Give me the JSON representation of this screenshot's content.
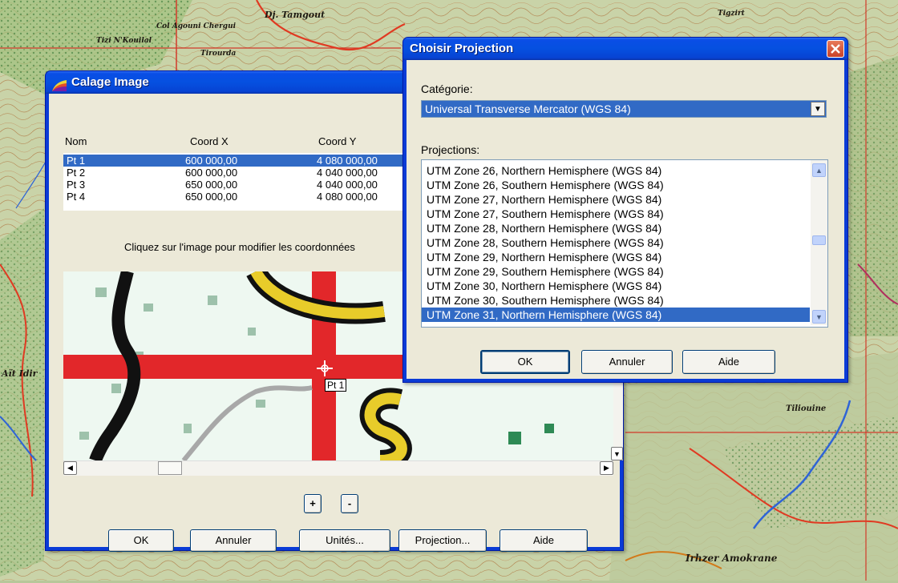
{
  "map": {
    "labels": [
      {
        "text": "Dj. Tamgout"
      },
      {
        "text": "Col Agouni Chergui"
      },
      {
        "text": "Tirourda"
      },
      {
        "text": "Tizi N'Kouilal"
      },
      {
        "text": "Irhzer Amokrane"
      },
      {
        "text": "Tigzirt"
      },
      {
        "text": "Tiliouine"
      },
      {
        "text": "Aït Idir"
      }
    ]
  },
  "calage": {
    "title": "Calage Image",
    "columns": [
      "Nom",
      "Coord X",
      "Coord Y"
    ],
    "points": [
      {
        "nom": "Pt 1",
        "x": "600 000,00",
        "y": "4 080 000,00",
        "selected": true
      },
      {
        "nom": "Pt 2",
        "x": "600 000,00",
        "y": "4 040 000,00",
        "selected": false
      },
      {
        "nom": "Pt 3",
        "x": "650 000,00",
        "y": "4 040 000,00",
        "selected": false
      },
      {
        "nom": "Pt 4",
        "x": "650 000,00",
        "y": "4 080 000,00",
        "selected": false
      }
    ],
    "instruction": "Cliquez sur l'image pour modifier les coordonnées",
    "marker_label": "Pt 1",
    "zoom_in": "+",
    "zoom_out": "-",
    "buttons": {
      "ok": "OK",
      "annuler": "Annuler",
      "unites": "Unités...",
      "projection": "Projection...",
      "aide": "Aide"
    }
  },
  "projection": {
    "title": "Choisir Projection",
    "categorie_label": "Catégorie:",
    "categorie_value": "Universal Transverse Mercator (WGS 84)",
    "projections_label": "Projections:",
    "items": [
      "UTM Zone 26, Northern Hemisphere (WGS 84)",
      "UTM Zone 26, Southern Hemisphere (WGS 84)",
      "UTM Zone 27, Northern Hemisphere (WGS 84)",
      "UTM Zone 27, Southern Hemisphere (WGS 84)",
      "UTM Zone 28, Northern Hemisphere (WGS 84)",
      "UTM Zone 28, Southern Hemisphere (WGS 84)",
      "UTM Zone 29, Northern Hemisphere (WGS 84)",
      "UTM Zone 29, Southern Hemisphere (WGS 84)",
      "UTM Zone 30, Northern Hemisphere (WGS 84)",
      "UTM Zone 30, Southern Hemisphere (WGS 84)",
      "UTM Zone 31, Northern Hemisphere (WGS 84)"
    ],
    "selected_index": 10,
    "buttons": {
      "ok": "OK",
      "annuler": "Annuler",
      "aide": "Aide"
    }
  }
}
